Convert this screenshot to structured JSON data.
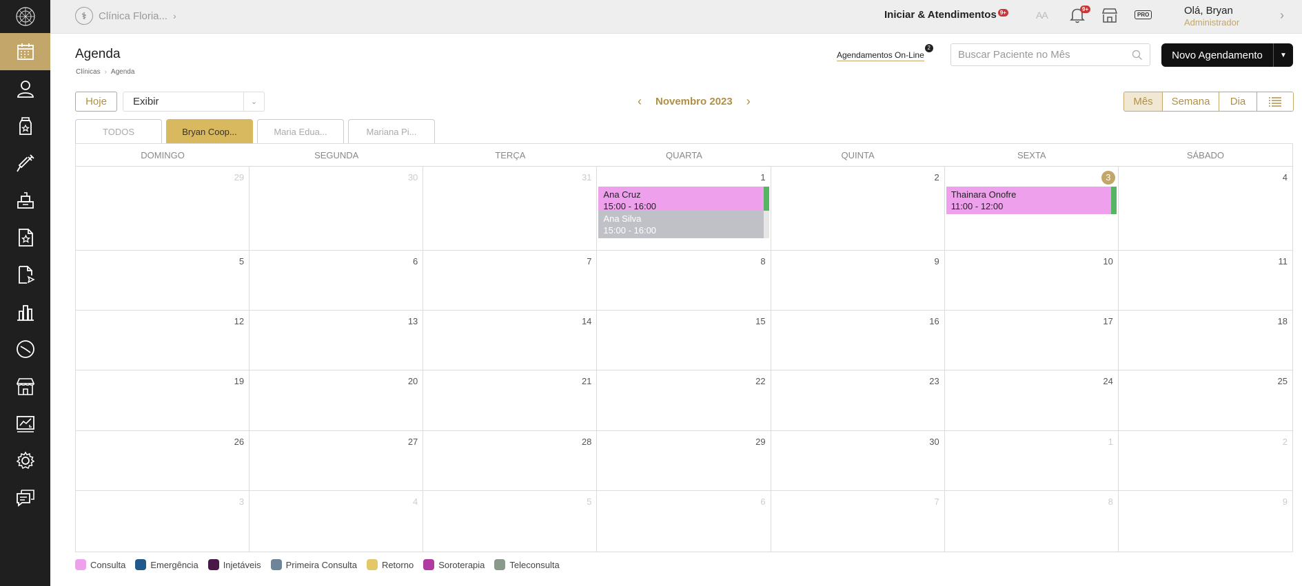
{
  "sidebar": {
    "items": [
      {
        "name": "calendar-icon",
        "active": true
      },
      {
        "name": "patient-icon",
        "active": false
      },
      {
        "name": "bottle-icon",
        "active": false
      },
      {
        "name": "syringe-icon",
        "active": false
      },
      {
        "name": "inventory-icon",
        "active": false
      },
      {
        "name": "star-document-icon",
        "active": false
      },
      {
        "name": "document-send-icon",
        "active": false
      },
      {
        "name": "reports-icon",
        "active": false
      },
      {
        "name": "dashboard-icon",
        "active": false
      },
      {
        "name": "store-icon",
        "active": false
      },
      {
        "name": "finance-icon",
        "active": false
      },
      {
        "name": "settings-icon",
        "active": false
      },
      {
        "name": "chat-icon",
        "active": false
      }
    ]
  },
  "topbar": {
    "clinic": "Clínica Floria...",
    "start_label": "Iniciar & Atendimentos",
    "start_badge": "9+",
    "font_size_label": "AA",
    "bell_badge": "9+",
    "pro_label": "PRO",
    "greeting": "Olá, Bryan",
    "role": "Administrador"
  },
  "header": {
    "title": "Agenda",
    "breadcrumb": [
      "Clínicas",
      "Agenda"
    ],
    "online_link": "Agendamentos On-Line",
    "online_count": "2",
    "search_placeholder": "Buscar Paciente no Mês",
    "new_button": "Novo Agendamento"
  },
  "controls": {
    "today": "Hoje",
    "display_select": "Exibir",
    "month": "Novembro 2023",
    "views": [
      "Mês",
      "Semana",
      "Dia"
    ],
    "active_view": "Mês"
  },
  "professionals": {
    "tabs": [
      "TODOS",
      "Bryan Coop...",
      "Maria Edua...",
      "Mariana Pi..."
    ],
    "active": 1
  },
  "calendar": {
    "weekdays": [
      "DOMINGO",
      "SEGUNDA",
      "TERÇA",
      "QUARTA",
      "QUINTA",
      "SEXTA",
      "SÁBADO"
    ],
    "weeks": [
      [
        {
          "d": "29",
          "m": true
        },
        {
          "d": "30",
          "m": true
        },
        {
          "d": "31",
          "m": true
        },
        {
          "d": "1"
        },
        {
          "d": "2"
        },
        {
          "d": "3",
          "today": true
        },
        {
          "d": "4"
        }
      ],
      [
        {
          "d": "5"
        },
        {
          "d": "6"
        },
        {
          "d": "7"
        },
        {
          "d": "8"
        },
        {
          "d": "9"
        },
        {
          "d": "10"
        },
        {
          "d": "11"
        }
      ],
      [
        {
          "d": "12"
        },
        {
          "d": "13"
        },
        {
          "d": "14"
        },
        {
          "d": "15"
        },
        {
          "d": "16"
        },
        {
          "d": "17"
        },
        {
          "d": "18"
        }
      ],
      [
        {
          "d": "19"
        },
        {
          "d": "20"
        },
        {
          "d": "21"
        },
        {
          "d": "22"
        },
        {
          "d": "23"
        },
        {
          "d": "24"
        },
        {
          "d": "25"
        }
      ],
      [
        {
          "d": "26"
        },
        {
          "d": "27"
        },
        {
          "d": "28"
        },
        {
          "d": "29"
        },
        {
          "d": "30"
        },
        {
          "d": "1",
          "m": true
        },
        {
          "d": "2",
          "m": true
        }
      ],
      [
        {
          "d": "3",
          "m": true
        },
        {
          "d": "4",
          "m": true
        },
        {
          "d": "5",
          "m": true
        },
        {
          "d": "6",
          "m": true
        },
        {
          "d": "7",
          "m": true
        },
        {
          "d": "8",
          "m": true
        },
        {
          "d": "9",
          "m": true
        }
      ]
    ],
    "events": [
      {
        "week": 0,
        "day": 3,
        "slot": 0,
        "name": "Ana Cruz",
        "time": "15:00 - 16:00",
        "style": "pink"
      },
      {
        "week": 0,
        "day": 3,
        "slot": 1,
        "name": "Ana Silva",
        "time": "15:00 - 16:00",
        "style": "gray"
      },
      {
        "week": 0,
        "day": 5,
        "slot": 0,
        "name": "Thainara Onofre",
        "time": "11:00 - 12:00",
        "style": "pink"
      }
    ]
  },
  "legend": [
    {
      "label": "Consulta",
      "color": "#eea0ec"
    },
    {
      "label": "Emergência",
      "color": "#1f5a8a"
    },
    {
      "label": "Injetáveis",
      "color": "#4a1848"
    },
    {
      "label": "Primeira Consulta",
      "color": "#6e8499"
    },
    {
      "label": "Retorno",
      "color": "#e3c86a"
    },
    {
      "label": "Soroterapia",
      "color": "#b03aa0"
    },
    {
      "label": "Teleconsulta",
      "color": "#8a9a8a"
    }
  ]
}
